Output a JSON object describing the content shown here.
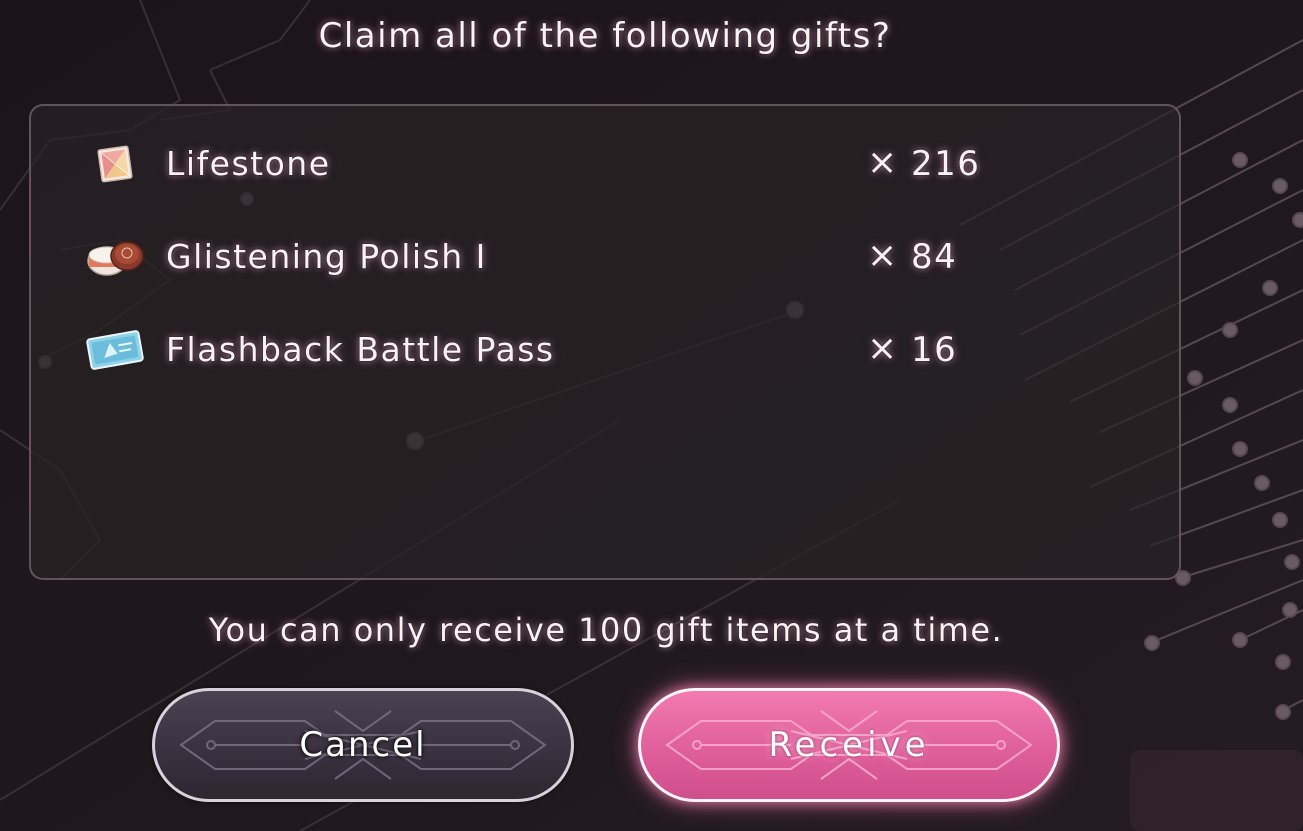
{
  "dialog": {
    "title": "Claim all of the following gifts?",
    "limit_notice": "You can only receive 100 gift items at a time."
  },
  "gifts": [
    {
      "icon": "lifestone-icon",
      "name": "Lifestone",
      "times_sign": "×",
      "quantity": "216"
    },
    {
      "icon": "polish-tin-icon",
      "name": "Glistening Polish I",
      "times_sign": "×",
      "quantity": "84"
    },
    {
      "icon": "battle-pass-ticket-icon",
      "name": "Flashback Battle Pass",
      "times_sign": "×",
      "quantity": "16"
    }
  ],
  "buttons": {
    "cancel_label": "Cancel",
    "receive_label": "Receive"
  },
  "colors": {
    "accent_pink": "#df5f9b",
    "panel_bg": "#2a2428",
    "text_glow": "#ffc8e1"
  }
}
